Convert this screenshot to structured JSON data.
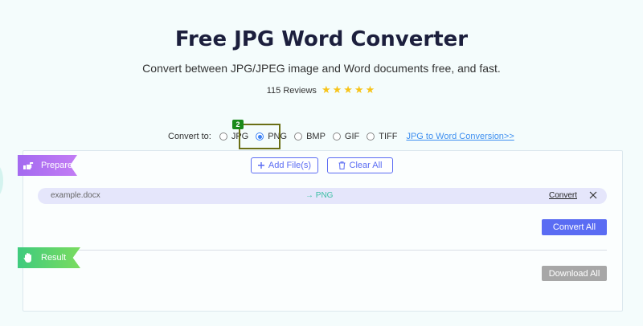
{
  "header": {
    "title": "Free JPG Word Converter",
    "subtitle": "Convert between JPG/JPEG image and Word documents free, and fast.",
    "reviews_label": "115 Reviews",
    "stars": "★★★★★"
  },
  "convert_to": {
    "label": "Convert to:",
    "options": [
      {
        "label": "JPG",
        "selected": false
      },
      {
        "label": "PNG",
        "selected": true
      },
      {
        "label": "BMP",
        "selected": false
      },
      {
        "label": "GIF",
        "selected": false
      },
      {
        "label": "TIFF",
        "selected": false
      }
    ],
    "link_label": "JPG to Word Conversion>>",
    "marker_badge": "2"
  },
  "prepare": {
    "tag_label": "Prepare",
    "add_files_label": "Add File(s)",
    "clear_all_label": "Clear All"
  },
  "files": [
    {
      "name": "example.docx",
      "target": "→ PNG",
      "action": "Convert"
    }
  ],
  "actions": {
    "convert_all_label": "Convert All",
    "download_all_label": "Download All"
  },
  "result": {
    "tag_label": "Result"
  },
  "colors": {
    "accent": "#5a6cf3",
    "prepare_tag": "#b073f2",
    "result_tag": "#5fd36c",
    "star": "#f7c41a",
    "link": "#3e8ff0"
  }
}
